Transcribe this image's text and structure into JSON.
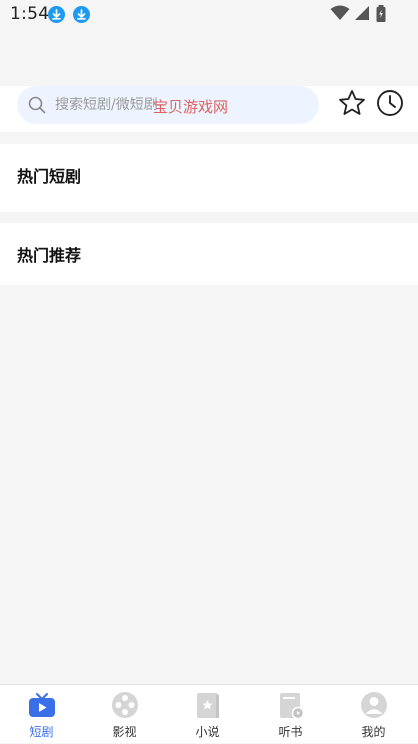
{
  "status_bar": {
    "time": "1:54",
    "icons": [
      "download-icon",
      "download-icon",
      "wifi-icon",
      "signal-icon",
      "battery-icon"
    ]
  },
  "search": {
    "placeholder": "搜索短剧/微短剧",
    "watermark": "宝贝游戏网",
    "icon": "search-icon"
  },
  "header_actions": {
    "favorites_icon": "star-icon",
    "history_icon": "clock-icon"
  },
  "sections": {
    "hot_drama": "热门短剧",
    "hot_recommend": "热门推荐"
  },
  "tabs": [
    {
      "label": "短剧",
      "icon": "tv-icon",
      "active": true
    },
    {
      "label": "影视",
      "icon": "film-reel-icon",
      "active": false
    },
    {
      "label": "小说",
      "icon": "book-icon",
      "active": false
    },
    {
      "label": "听书",
      "icon": "audiobook-icon",
      "active": false
    },
    {
      "label": "我的",
      "icon": "user-icon",
      "active": false
    }
  ],
  "colors": {
    "accent": "#3a6fe8",
    "download_badge": "#1e9bf0",
    "search_bg": "#eef4ff",
    "page_bg": "#f5f5f5",
    "watermark": "#d9534f"
  }
}
